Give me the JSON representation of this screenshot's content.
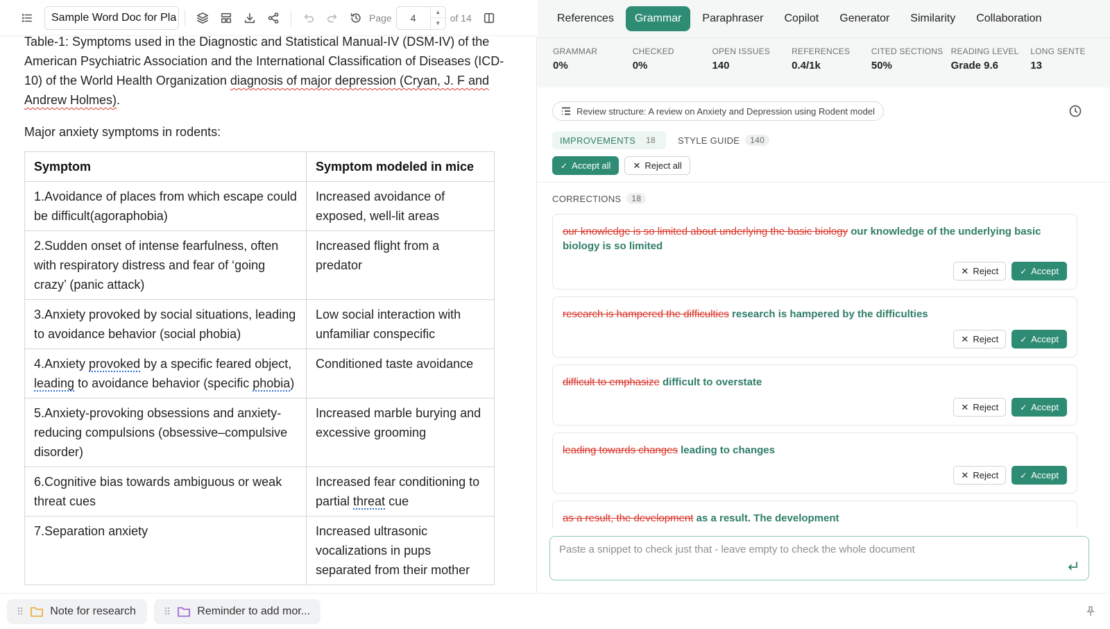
{
  "toolbar": {
    "doc_title": "Sample Word Doc for Pla",
    "page_label": "Page",
    "page_value": "4",
    "of_label": "of 14"
  },
  "document": {
    "caption_parts": [
      "Table-1: Symptoms used in the Diagnostic and Statistical Manual-IV (DSM-IV) of the American Psychiatric Association and the International Classification of Diseases (ICD-10) of the World Health Organization ",
      "diagnosis of major depression (Cryan, J. F and Andrew Holmes)",
      "."
    ],
    "subheading": "Major anxiety symptoms in rodents:",
    "table": {
      "headers": [
        "Symptom",
        "Symptom modeled in mice"
      ],
      "rows": [
        [
          "1.Avoidance of places from which escape could be difficult(agoraphobia)",
          "Increased avoidance of exposed, well-lit areas"
        ],
        [
          "2.Sudden onset of intense fearfulness, often with respiratory distress and fear of ‘going crazy’ (panic attack)",
          "Increased flight from a predator"
        ],
        [
          "3.Anxiety provoked by social situations, leading to avoidance behavior (social phobia)",
          "Low social interaction with unfamiliar conspecific"
        ],
        [
          "4.Anxiety provoked by a specific feared object, leading to avoidance behavior (specific phobia)",
          "Conditioned taste avoidance"
        ],
        [
          "5.Anxiety-provoking obsessions and anxiety-reducing compulsions (obsessive–compulsive disorder)",
          "Increased marble burying and excessive grooming"
        ],
        [
          "6.Cognitive bias towards ambiguous or weak threat cues",
          "Increased fear conditioning to partial threat cue"
        ],
        [
          "7.Separation anxiety",
          "Increased ultrasonic vocalizations in pups separated from their mother"
        ]
      ],
      "row4_parts": [
        "4.Anxiety ",
        "provoked",
        " by a specific feared object, ",
        "leading",
        " to avoidance behavior (specific ",
        "phobia",
        ")"
      ],
      "row6_parts": [
        "Increased fear conditioning to partial ",
        "threat",
        " cue"
      ]
    }
  },
  "notes": [
    {
      "label": "Note for research",
      "color": "#f0a82a"
    },
    {
      "label": "Reminder to add mor...",
      "color": "#9b59d0"
    }
  ],
  "panel": {
    "tabs": [
      "References",
      "Grammar",
      "Paraphraser",
      "Copilot",
      "Generator",
      "Similarity",
      "Collaboration"
    ],
    "stats": [
      {
        "label": "GRAMMAR",
        "value": "0%"
      },
      {
        "label": "CHECKED",
        "value": "0%"
      },
      {
        "label": "OPEN ISSUES",
        "value": "140"
      },
      {
        "label": "REFERENCES",
        "value": "0.4/1k"
      },
      {
        "label": "CITED SECTIONS",
        "value": "50%"
      },
      {
        "label": "READING LEVEL",
        "value": "Grade 9.6"
      },
      {
        "label": "LONG SENTE",
        "value": "13"
      }
    ],
    "review_label": "Review structure: A review on Anxiety and Depression using Rodent model",
    "subtabs": [
      {
        "label": "IMPROVEMENTS",
        "count": "18"
      },
      {
        "label": "STYLE GUIDE",
        "count": "140"
      }
    ],
    "accept_all": "Accept all",
    "reject_all": "Reject all",
    "corrections_label": "CORRECTIONS",
    "corrections_count": "18",
    "reject_label": "Reject",
    "accept_label": "Accept",
    "corrections": [
      {
        "old": "our knowledge is so limited about underlying the basic biology",
        "new": "our knowledge of the underlying basic biology is so limited"
      },
      {
        "old": "research is hampered the difficulties",
        "new": "research is hampered by the difficulties"
      },
      {
        "old": "difficult to emphasize",
        "new": "difficult to overstate"
      },
      {
        "old": "leading towards changes",
        "new": "leading to changes"
      },
      {
        "old": "as a result, the development",
        "new": "as a result. The development"
      }
    ],
    "snippet_placeholder": "Paste a snippet to check just that - leave empty to check the whole document"
  },
  "colors": {
    "accent": "#2f8c74",
    "error": "#d9362b",
    "suggestion": "#2f7d68"
  }
}
